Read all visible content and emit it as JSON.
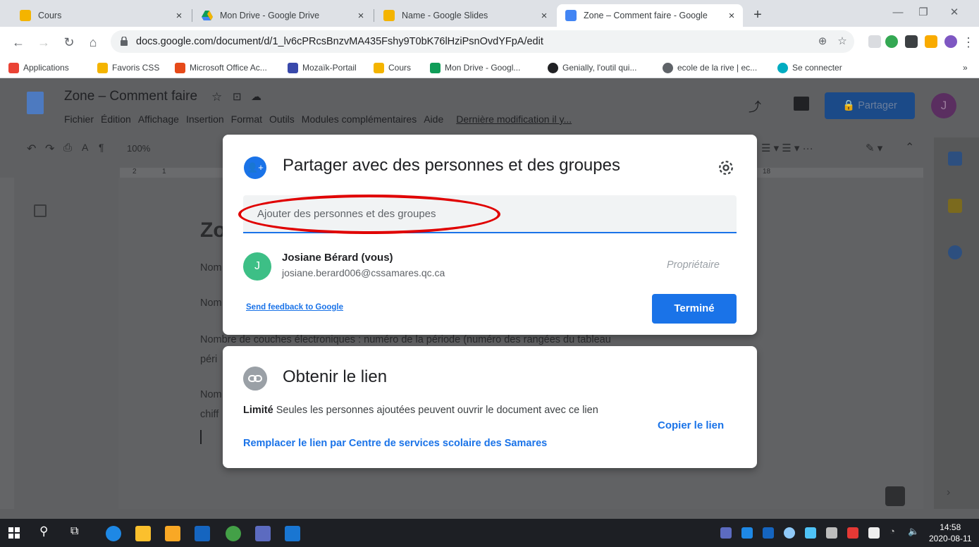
{
  "browser": {
    "tabs": [
      {
        "title": "Cours",
        "color": "#f4b400"
      },
      {
        "title": "Mon Drive - Google Drive",
        "color": "#0f9d58"
      },
      {
        "title": "Name - Google Slides",
        "color": "#f4b400"
      },
      {
        "title": "Zone – Comment faire - Google",
        "color": "#4285f4"
      }
    ],
    "tab_close": "×",
    "new_tab": "+",
    "url": "docs.google.com/document/d/1_lv6cPRcsBnzvMA435Fshy9T0bK76lHziPsnOvdYFpA/edit",
    "bookmarks": [
      {
        "label": "Applications",
        "color": "#ea4335"
      },
      {
        "label": "Favoris CSS",
        "color": "#f4b400"
      },
      {
        "label": "Microsoft Office Ac...",
        "color": "#e64a19"
      },
      {
        "label": "Mozaïk-Portail",
        "color": "#3949ab"
      },
      {
        "label": "Cours",
        "color": "#f4b400"
      },
      {
        "label": "Mon Drive - Googl...",
        "color": "#0f9d58"
      },
      {
        "label": "Genially, l'outil qui...",
        "color": "#202124"
      },
      {
        "label": "ecole de la rive | ec...",
        "color": "#5f6368"
      },
      {
        "label": "Se connecter",
        "color": "#00acc1"
      }
    ],
    "bookmarks_more": "»"
  },
  "docs": {
    "title": "Zone – Comment faire",
    "menu": [
      "Fichier",
      "Édition",
      "Affichage",
      "Insertion",
      "Format",
      "Outils",
      "Modules complémentaires",
      "Aide"
    ],
    "last_edit": "Dernière modification il y...",
    "share_label": "Partager",
    "avatar_letter": "J",
    "zoom": "100%",
    "ruler_marks": [
      "2",
      "1",
      "18"
    ],
    "content": {
      "heading": "Zo",
      "line1": "Nom",
      "line2": "Nom",
      "line3": "Nombre de couches électroniques : numéro de la période (numéro des rangées du tableau",
      "line4": "péri",
      "line5": "Nom",
      "line6": "chiff"
    }
  },
  "share_dialog": {
    "title": "Partager avec des personnes et des groupes",
    "input_placeholder": "Ajouter des personnes et des groupes",
    "user": {
      "initial": "J",
      "name": "Josiane Bérard (vous)",
      "email": "josiane.berard006@cssamares.qc.ca",
      "role": "Propriétaire"
    },
    "feedback_link": "Send feedback to Google",
    "done_button": "Terminé"
  },
  "link_dialog": {
    "title": "Obtenir le lien",
    "access_bold": "Limité",
    "access_desc": "Seules les personnes ajoutées peuvent ouvrir le document avec ce lien",
    "replace_link": "Remplacer le lien par Centre de services scolaire des Samares",
    "copy_link": "Copier le lien"
  },
  "taskbar": {
    "time": "14:58",
    "date": "2020-08-11"
  }
}
